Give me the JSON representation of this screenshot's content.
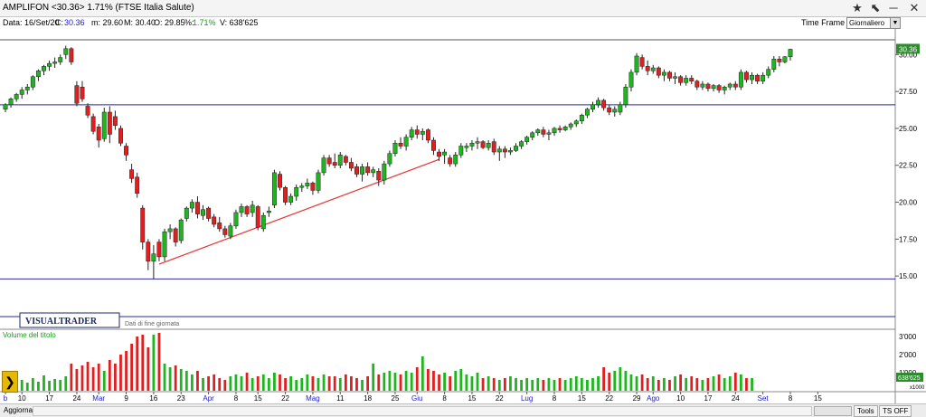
{
  "window": {
    "title": "AMPLIFON <30.36> 1.71%  (FTSE Italia Salute)"
  },
  "infobar": {
    "date_label": "Data: 16/Set/20",
    "close_label": "C:",
    "close_value": "30.36",
    "min_label": "m: 29.60",
    "max_label": "M: 30.40",
    "open_label": "O: 29.85",
    "pct_label": "%:",
    "pct_value": "1.71%",
    "vol_label": "V: 638'625"
  },
  "timeframe": {
    "label": "Time Frame",
    "selected": "Giornaliero"
  },
  "statusbar": {
    "aggiorna": "Aggiorna",
    "tools": "Tools",
    "tsoff": "TS OFF"
  },
  "brand": {
    "logo_text": "VISUALTRADER",
    "note": "Dati di fine giornata"
  },
  "volume_label": "Volume del titolo",
  "colors": {
    "up": "#1eb51e",
    "down": "#e02020",
    "hline": "#2a2aa0",
    "trend": "#e83030",
    "price_tag": "#2e8b2e",
    "volume_label": "#1a9a1a",
    "month_label": "#1a1ad0"
  },
  "chart_data": {
    "type": "candlestick",
    "price_axis": {
      "ticks": [
        "15.00",
        "17.50",
        "20.00",
        "22.50",
        "25.00",
        "27.50",
        "30.00"
      ],
      "ylim": [
        13.6,
        31.0
      ]
    },
    "volume_axis": {
      "ticks": [
        "1'000",
        "2'000",
        "3'000"
      ],
      "unit": "x1000"
    },
    "last_price_tag": "30.36",
    "last_volume_tag": "638'625",
    "x_labels": [
      {
        "t": "b",
        "i": 0,
        "month": true
      },
      {
        "t": "10",
        "i": 3
      },
      {
        "t": "17",
        "i": 8
      },
      {
        "t": "24",
        "i": 13
      },
      {
        "t": "Mar",
        "i": 17,
        "month": true
      },
      {
        "t": "9",
        "i": 22
      },
      {
        "t": "16",
        "i": 27
      },
      {
        "t": "23",
        "i": 32
      },
      {
        "t": "Apr",
        "i": 37,
        "month": true
      },
      {
        "t": "8",
        "i": 42
      },
      {
        "t": "15",
        "i": 46
      },
      {
        "t": "22",
        "i": 51
      },
      {
        "t": "Mag",
        "i": 56,
        "month": true
      },
      {
        "t": "11",
        "i": 61
      },
      {
        "t": "18",
        "i": 66
      },
      {
        "t": "25",
        "i": 71
      },
      {
        "t": "Giu",
        "i": 75,
        "month": true
      },
      {
        "t": "8",
        "i": 80
      },
      {
        "t": "15",
        "i": 85
      },
      {
        "t": "22",
        "i": 90
      },
      {
        "t": "Lug",
        "i": 95,
        "month": true
      },
      {
        "t": "8",
        "i": 100
      },
      {
        "t": "15",
        "i": 105
      },
      {
        "t": "22",
        "i": 110
      },
      {
        "t": "29",
        "i": 115
      },
      {
        "t": "Ago",
        "i": 118,
        "month": true
      },
      {
        "t": "10",
        "i": 123
      },
      {
        "t": "17",
        "i": 128
      },
      {
        "t": "24",
        "i": 133
      },
      {
        "t": "Set",
        "i": 138,
        "month": true
      },
      {
        "t": "8",
        "i": 143
      },
      {
        "t": "15",
        "i": 148
      }
    ],
    "horizontal_lines": [
      26.6,
      14.8
    ],
    "trendline": [
      {
        "i": 28,
        "v": 15.8
      },
      {
        "i": 79,
        "v": 22.9
      }
    ],
    "ohlc": [
      [
        26.3,
        26.7,
        26.1,
        26.6
      ],
      [
        26.6,
        27.1,
        26.4,
        27.0
      ],
      [
        27.0,
        27.4,
        26.8,
        27.3
      ],
      [
        27.3,
        27.8,
        27.0,
        27.6
      ],
      [
        27.6,
        28.0,
        27.3,
        27.8
      ],
      [
        27.8,
        28.6,
        27.6,
        28.5
      ],
      [
        28.5,
        29.0,
        28.2,
        28.9
      ],
      [
        28.9,
        29.3,
        28.6,
        29.2
      ],
      [
        29.2,
        29.6,
        28.9,
        29.4
      ],
      [
        29.4,
        29.8,
        29.1,
        29.5
      ],
      [
        29.5,
        30.0,
        29.3,
        29.8
      ],
      [
        30.0,
        30.6,
        29.7,
        30.4
      ],
      [
        30.4,
        30.5,
        29.3,
        29.5
      ],
      [
        27.9,
        28.2,
        26.5,
        26.7
      ],
      [
        27.8,
        28.2,
        26.8,
        27.0
      ],
      [
        26.5,
        26.7,
        25.7,
        25.9
      ],
      [
        25.8,
        26.0,
        24.6,
        24.8
      ],
      [
        25.1,
        25.3,
        23.7,
        24.2
      ],
      [
        24.3,
        26.4,
        24.1,
        26.1
      ],
      [
        26.1,
        26.5,
        24.0,
        24.6
      ],
      [
        25.8,
        26.2,
        24.9,
        25.2
      ],
      [
        25.0,
        25.2,
        23.8,
        24.0
      ],
      [
        23.8,
        24.0,
        22.8,
        23.2
      ],
      [
        22.2,
        22.6,
        21.3,
        21.6
      ],
      [
        21.7,
        22.0,
        20.3,
        20.6
      ],
      [
        19.6,
        19.8,
        16.8,
        17.3
      ],
      [
        17.3,
        17.5,
        15.4,
        16.0
      ],
      [
        16.0,
        17.1,
        14.8,
        16.5
      ],
      [
        17.3,
        17.5,
        16.0,
        16.3
      ],
      [
        16.3,
        18.2,
        16.0,
        18.0
      ],
      [
        18.0,
        18.5,
        17.5,
        18.2
      ],
      [
        18.2,
        18.3,
        17.0,
        17.3
      ],
      [
        17.4,
        18.9,
        17.2,
        18.8
      ],
      [
        18.9,
        19.7,
        18.7,
        19.6
      ],
      [
        19.6,
        20.2,
        19.3,
        20.0
      ],
      [
        20.0,
        20.4,
        18.9,
        19.2
      ],
      [
        19.1,
        19.8,
        18.8,
        19.5
      ],
      [
        19.6,
        19.7,
        18.7,
        18.9
      ],
      [
        19.0,
        19.2,
        18.3,
        18.5
      ],
      [
        18.6,
        19.0,
        18.0,
        18.2
      ],
      [
        18.2,
        18.4,
        17.6,
        17.8
      ],
      [
        17.7,
        18.6,
        17.5,
        18.4
      ],
      [
        18.4,
        19.5,
        18.2,
        19.3
      ],
      [
        19.3,
        19.9,
        19.0,
        19.7
      ],
      [
        19.7,
        19.8,
        19.0,
        19.2
      ],
      [
        19.3,
        20.1,
        19.0,
        19.8
      ],
      [
        19.7,
        19.8,
        18.1,
        18.3
      ],
      [
        18.2,
        19.3,
        18.0,
        19.1
      ],
      [
        19.3,
        19.7,
        19.0,
        19.4
      ],
      [
        19.8,
        22.2,
        19.6,
        22.0
      ],
      [
        21.9,
        22.1,
        20.8,
        21.0
      ],
      [
        21.0,
        21.1,
        19.8,
        20.0
      ],
      [
        20.0,
        20.6,
        19.8,
        20.4
      ],
      [
        20.4,
        21.2,
        20.1,
        21.0
      ],
      [
        21.0,
        21.3,
        20.7,
        21.1
      ],
      [
        21.1,
        21.6,
        20.9,
        21.3
      ],
      [
        21.3,
        21.4,
        20.5,
        20.8
      ],
      [
        20.8,
        22.2,
        20.6,
        22.0
      ],
      [
        22.0,
        23.2,
        21.8,
        23.0
      ],
      [
        23.0,
        23.2,
        22.4,
        22.6
      ],
      [
        22.7,
        23.3,
        22.3,
        22.5
      ],
      [
        22.5,
        23.4,
        22.3,
        23.2
      ],
      [
        23.1,
        23.2,
        22.5,
        22.7
      ],
      [
        22.7,
        23.0,
        22.1,
        22.3
      ],
      [
        22.4,
        22.6,
        21.7,
        21.9
      ],
      [
        21.9,
        22.6,
        21.4,
        22.4
      ],
      [
        22.4,
        22.7,
        21.8,
        22.0
      ],
      [
        22.0,
        22.4,
        21.7,
        22.2
      ],
      [
        22.1,
        22.3,
        21.1,
        21.5
      ],
      [
        21.5,
        22.8,
        21.2,
        22.6
      ],
      [
        22.6,
        23.5,
        22.4,
        23.3
      ],
      [
        23.3,
        24.2,
        23.1,
        24.0
      ],
      [
        24.0,
        24.4,
        23.6,
        23.8
      ],
      [
        23.8,
        24.6,
        23.5,
        24.4
      ],
      [
        24.4,
        25.1,
        24.2,
        24.9
      ],
      [
        24.9,
        25.2,
        24.3,
        24.6
      ],
      [
        24.6,
        25.0,
        24.2,
        24.8
      ],
      [
        24.9,
        25.0,
        24.0,
        24.2
      ],
      [
        24.2,
        24.4,
        23.2,
        23.5
      ],
      [
        23.4,
        23.6,
        22.8,
        23.1
      ],
      [
        23.2,
        23.6,
        22.6,
        23.4
      ],
      [
        23.0,
        23.2,
        22.4,
        22.6
      ],
      [
        22.6,
        23.4,
        22.4,
        23.2
      ],
      [
        23.2,
        24.0,
        23.0,
        23.8
      ],
      [
        23.7,
        24.0,
        23.4,
        23.8
      ],
      [
        23.8,
        24.2,
        23.5,
        24.0
      ],
      [
        24.0,
        24.4,
        23.6,
        24.1
      ],
      [
        24.1,
        24.2,
        23.6,
        23.7
      ],
      [
        23.7,
        24.2,
        23.5,
        24.0
      ],
      [
        24.1,
        24.3,
        23.2,
        23.4
      ],
      [
        23.4,
        23.8,
        22.8,
        23.6
      ],
      [
        23.6,
        23.8,
        23.0,
        23.4
      ],
      [
        23.4,
        23.7,
        23.2,
        23.5
      ],
      [
        23.5,
        24.0,
        23.4,
        23.8
      ],
      [
        23.8,
        24.2,
        23.6,
        24.1
      ],
      [
        24.1,
        24.5,
        23.9,
        24.4
      ],
      [
        24.4,
        24.8,
        24.2,
        24.7
      ],
      [
        24.7,
        25.0,
        24.5,
        24.9
      ],
      [
        24.9,
        25.1,
        24.4,
        24.6
      ],
      [
        24.6,
        24.9,
        24.2,
        24.7
      ],
      [
        24.7,
        25.1,
        24.5,
        25.0
      ],
      [
        25.0,
        25.2,
        24.7,
        24.9
      ],
      [
        24.9,
        25.2,
        24.8,
        25.1
      ],
      [
        25.1,
        25.4,
        24.9,
        25.3
      ],
      [
        25.3,
        25.6,
        25.1,
        25.5
      ],
      [
        25.5,
        26.0,
        25.3,
        25.9
      ],
      [
        25.9,
        26.4,
        25.7,
        26.3
      ],
      [
        26.3,
        26.8,
        26.1,
        26.6
      ],
      [
        26.6,
        27.1,
        26.4,
        26.9
      ],
      [
        26.9,
        27.0,
        26.2,
        26.4
      ],
      [
        26.4,
        26.6,
        25.9,
        26.1
      ],
      [
        26.1,
        26.5,
        25.8,
        26.3
      ],
      [
        26.1,
        26.8,
        25.9,
        26.6
      ],
      [
        26.6,
        28.0,
        26.4,
        27.8
      ],
      [
        27.8,
        29.0,
        27.5,
        28.8
      ],
      [
        28.8,
        30.1,
        28.6,
        29.9
      ],
      [
        29.8,
        30.0,
        29.0,
        29.2
      ],
      [
        29.2,
        29.6,
        28.6,
        28.9
      ],
      [
        28.9,
        29.3,
        28.7,
        29.1
      ],
      [
        29.1,
        29.2,
        28.4,
        28.6
      ],
      [
        28.6,
        29.0,
        28.2,
        28.8
      ],
      [
        28.8,
        28.9,
        28.2,
        28.4
      ],
      [
        28.4,
        28.8,
        28.0,
        28.5
      ],
      [
        28.5,
        28.6,
        27.9,
        28.1
      ],
      [
        28.1,
        28.6,
        27.9,
        28.4
      ],
      [
        28.4,
        28.6,
        28.0,
        28.2
      ],
      [
        28.2,
        28.3,
        27.6,
        27.8
      ],
      [
        27.8,
        28.2,
        27.6,
        28.0
      ],
      [
        28.0,
        28.1,
        27.5,
        27.7
      ],
      [
        27.7,
        28.0,
        27.5,
        27.9
      ],
      [
        27.9,
        28.0,
        27.4,
        27.6
      ],
      [
        27.6,
        27.9,
        27.3,
        27.8
      ],
      [
        27.8,
        28.1,
        27.6,
        28.0
      ],
      [
        28.0,
        28.2,
        27.6,
        27.8
      ],
      [
        27.8,
        29.0,
        27.6,
        28.8
      ],
      [
        28.8,
        28.9,
        28.1,
        28.3
      ],
      [
        28.3,
        28.8,
        28.0,
        28.6
      ],
      [
        28.6,
        28.7,
        28.0,
        28.2
      ],
      [
        28.2,
        28.8,
        28.0,
        28.6
      ],
      [
        28.6,
        29.2,
        28.4,
        29.0
      ],
      [
        29.0,
        29.9,
        28.8,
        29.7
      ],
      [
        29.7,
        29.9,
        29.2,
        29.5
      ],
      [
        29.5,
        29.9,
        29.4,
        29.85
      ],
      [
        29.85,
        30.4,
        29.6,
        30.36
      ]
    ],
    "volume": [
      400,
      700,
      500,
      600,
      450,
      700,
      500,
      850,
      550,
      650,
      600,
      800,
      1500,
      1200,
      1400,
      1600,
      1300,
      1500,
      1100,
      1700,
      1500,
      2000,
      2200,
      2600,
      3000,
      3100,
      2400,
      3100,
      3200,
      1500,
      1300,
      1400,
      1200,
      1100,
      900,
      1100,
      700,
      800,
      900,
      700,
      600,
      800,
      900,
      800,
      1000,
      700,
      800,
      900,
      700,
      1000,
      900,
      700,
      800,
      600,
      700,
      900,
      800,
      700,
      900,
      800,
      800,
      700,
      900,
      800,
      700,
      600,
      800,
      1500,
      900,
      1000,
      1100,
      1000,
      900,
      1100,
      1000,
      1300,
      1900,
      1200,
      1100,
      900,
      1000,
      800,
      1100,
      1200,
      900,
      800,
      1000,
      700,
      800,
      700,
      600,
      700,
      800,
      700,
      600,
      700,
      600,
      700,
      600,
      700,
      600,
      700,
      600,
      700,
      800,
      700,
      600,
      700,
      800,
      1300,
      1000,
      1100,
      1300,
      1100,
      900,
      800,
      900,
      700,
      800,
      600,
      700,
      600,
      800,
      900,
      700,
      800,
      700,
      600,
      700,
      800,
      900,
      700,
      800,
      1000,
      900,
      700,
      700
    ]
  }
}
